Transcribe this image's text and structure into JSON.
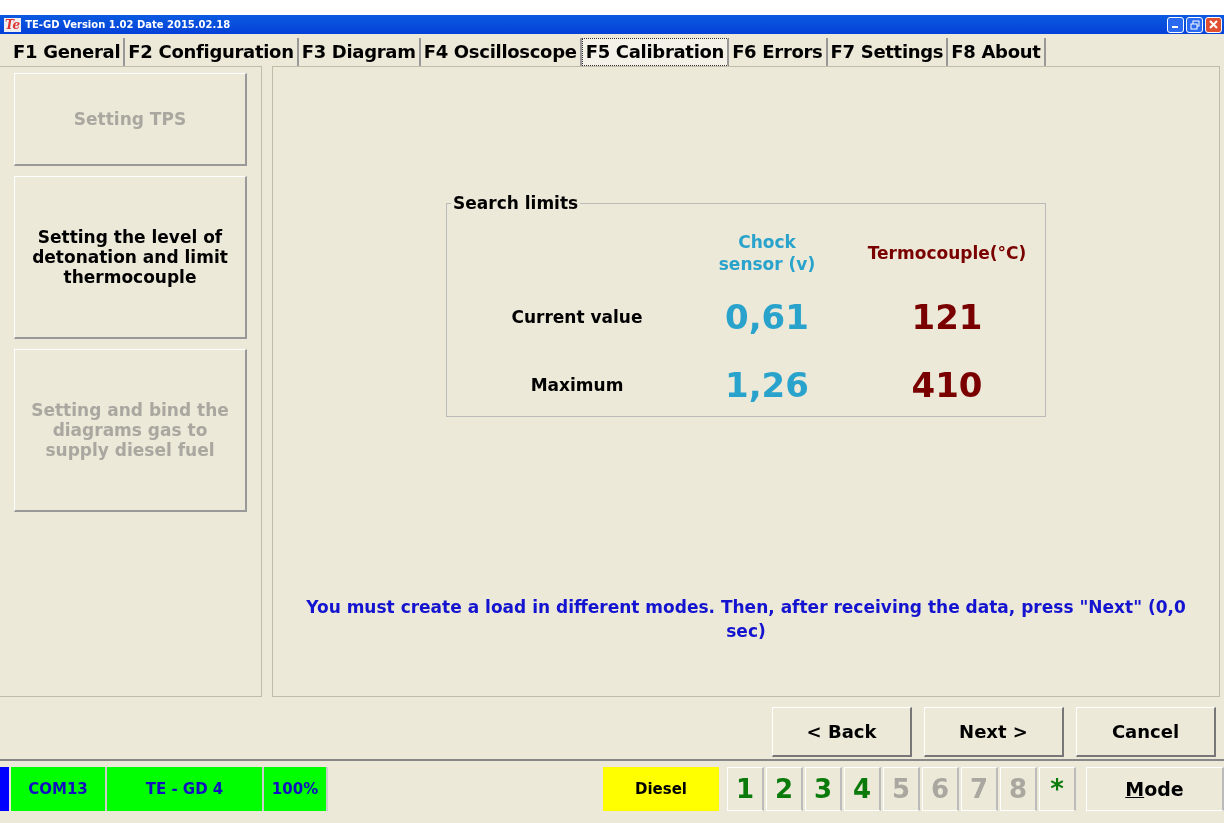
{
  "window": {
    "title": "TE-GD  Version 1.02  Date 2015.02.18",
    "app_icon": "Te"
  },
  "tabs": [
    {
      "label": "F1 General",
      "selected": false
    },
    {
      "label": "F2 Configuration",
      "selected": false
    },
    {
      "label": "F3 Diagram",
      "selected": false
    },
    {
      "label": "F4 Oscilloscope",
      "selected": false
    },
    {
      "label": "F5 Calibration",
      "selected": true
    },
    {
      "label": "F6 Errors",
      "selected": false
    },
    {
      "label": "F7 Settings",
      "selected": false
    },
    {
      "label": "F8 About",
      "selected": false
    }
  ],
  "sidebar": {
    "items": [
      {
        "label": "Setting TPS",
        "disabled": true
      },
      {
        "label": "Setting the level of detonation and limit thermocouple",
        "disabled": false
      },
      {
        "label": "Setting and bind the diagrams gas to supply diesel fuel",
        "disabled": true
      }
    ]
  },
  "search_limits": {
    "title": "Search limits",
    "columns": [
      {
        "label": "Chock sensor (v)",
        "color": "#29a3cc"
      },
      {
        "label": "Termocouple(°C)",
        "color": "#7a0000"
      }
    ],
    "rows": [
      {
        "label": "Current value",
        "values": [
          "0,61",
          "121"
        ]
      },
      {
        "label": "Maximum",
        "values": [
          "1,26",
          "410"
        ]
      }
    ]
  },
  "message": "You must create a load in different modes. Then, after receiving the data, press \"Next\" (0,0 sec)",
  "buttons": [
    "< Back",
    "Next >",
    "Cancel"
  ],
  "status_bar": {
    "fields": [
      {
        "text": "COM13",
        "color": "#00ff00"
      },
      {
        "text": "TE - GD 4",
        "color": "#00ff00"
      },
      {
        "text": "100%",
        "color": "#00ff00"
      }
    ],
    "fuel": {
      "text": "Diesel",
      "color": "#ffff00"
    },
    "cylinders": [
      {
        "label": "1",
        "disabled": false
      },
      {
        "label": "2",
        "disabled": false
      },
      {
        "label": "3",
        "disabled": false
      },
      {
        "label": "4",
        "disabled": false
      },
      {
        "label": "5",
        "disabled": true
      },
      {
        "label": "6",
        "disabled": true
      },
      {
        "label": "7",
        "disabled": true
      },
      {
        "label": "8",
        "disabled": true
      },
      {
        "label": "*",
        "disabled": false
      }
    ],
    "mode_button": {
      "label": "Mode",
      "mnemonic_underlined": true
    }
  }
}
